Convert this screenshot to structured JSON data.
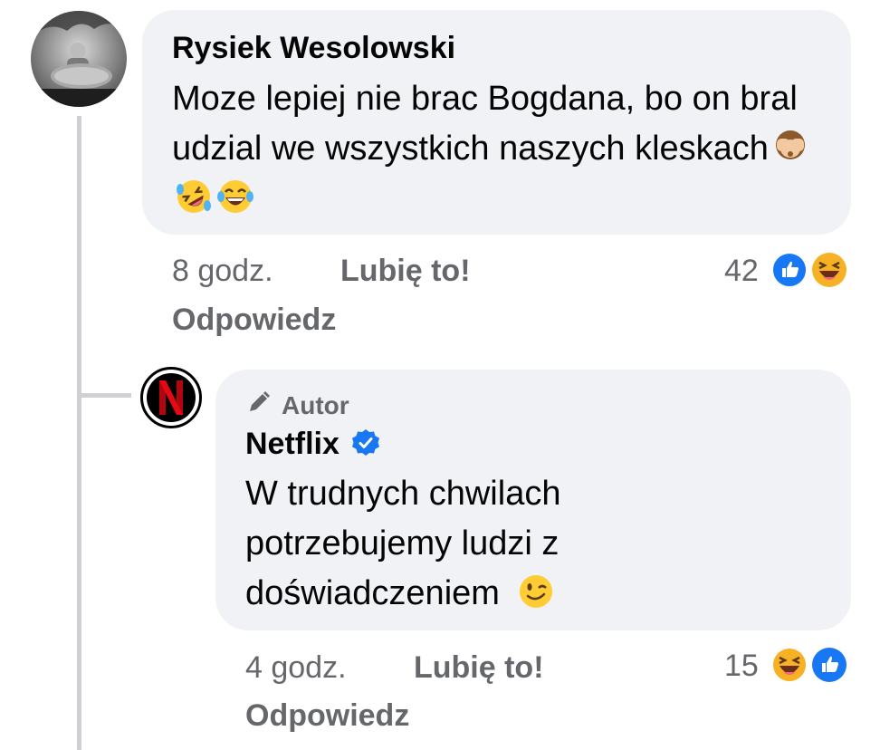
{
  "comment": {
    "author": "Rysiek Wesolowski",
    "text": "Moze lepiej nie brac Bogdana, bo on bral udzial we wszystkich naszych kleskach",
    "emojis": [
      "see-no-evil-monkey",
      "rolling-on-floor-laughing",
      "face-with-tears-of-joy"
    ],
    "time": "8 godz.",
    "like_label": "Lubię to!",
    "reply_label": "Odpowiedz",
    "reaction_count": "42",
    "reactions": [
      "like",
      "haha"
    ]
  },
  "reply": {
    "author_badge": "Autor",
    "author": "Netflix",
    "verified": true,
    "text": "W trudnych chwilach potrzebujemy ludzi z doświadczeniem",
    "emojis": [
      "winking-face"
    ],
    "time": "4 godz.",
    "like_label": "Lubię to!",
    "reply_label": "Odpowiedz",
    "reaction_count": "15",
    "reactions": [
      "haha",
      "like"
    ],
    "avatar_letter": "N"
  },
  "colors": {
    "bubble": "#f0f2f5",
    "meta": "#65676b",
    "like_blue": "#1877f2",
    "netflix_red": "#e50914",
    "haha_yellow": "#f7b125"
  }
}
